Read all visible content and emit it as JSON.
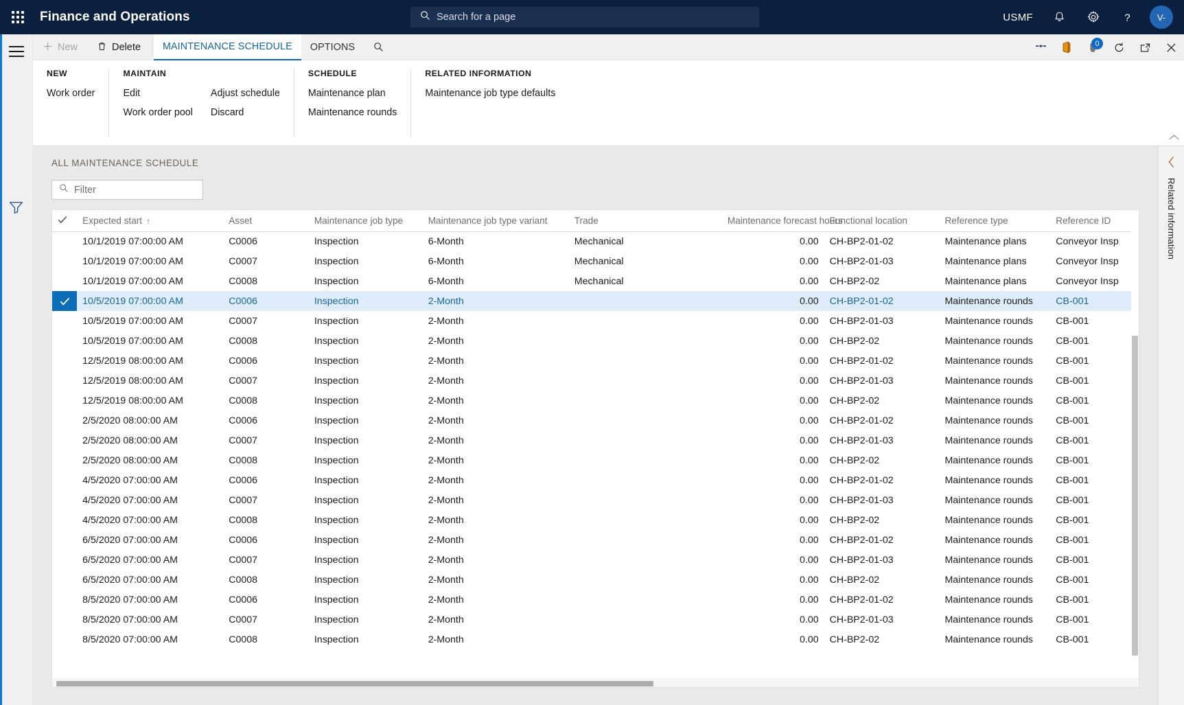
{
  "header": {
    "app_title": "Finance and Operations",
    "waffle_icon": "app-launcher-icon",
    "search": {
      "placeholder": "Search for a page",
      "icon": "search-icon"
    },
    "company": "USMF",
    "notifications_icon": "bell-icon",
    "settings_icon": "gear-icon",
    "help_icon": "question-icon",
    "avatar_initials": "V-",
    "accent_color": "#0b1f3f"
  },
  "left_rail": {
    "menu_icon": "hamburger-menu-icon",
    "filter_icon": "filter-funnel-icon"
  },
  "action_pane": {
    "buttons": [
      {
        "label": "New",
        "icon": "plus-icon",
        "disabled": true
      },
      {
        "label": "Delete",
        "icon": "trash-icon",
        "disabled": false
      }
    ],
    "tabs": [
      {
        "label": "MAINTENANCE SCHEDULE",
        "active": true
      },
      {
        "label": "OPTIONS",
        "active": false
      }
    ],
    "tab_search_icon": "search-icon",
    "right_icons": [
      {
        "name": "share-icon",
        "badge": null
      },
      {
        "name": "office-app-icon",
        "badge": null
      },
      {
        "name": "attachment-icon",
        "badge": "0"
      },
      {
        "name": "refresh-icon",
        "badge": null
      },
      {
        "name": "popout-icon",
        "badge": null
      },
      {
        "name": "close-icon",
        "badge": null
      }
    ],
    "collapse_icon": "chevron-up-icon",
    "groups": [
      {
        "title": "NEW",
        "columns": [
          {
            "items": [
              "Work order"
            ]
          }
        ]
      },
      {
        "title": "MAINTAIN",
        "columns": [
          {
            "items": [
              "Edit",
              "Work order pool"
            ]
          },
          {
            "items": [
              "Adjust schedule",
              "Discard"
            ]
          }
        ]
      },
      {
        "title": "SCHEDULE",
        "columns": [
          {
            "items": [
              "Maintenance plan",
              "Maintenance rounds"
            ]
          }
        ]
      },
      {
        "title": "RELATED INFORMATION",
        "columns": [
          {
            "items": [
              "Maintenance job type defaults"
            ]
          }
        ]
      }
    ]
  },
  "content": {
    "grid_caption": "ALL MAINTENANCE SCHEDULE",
    "filter": {
      "placeholder": "Filter",
      "value": "",
      "icon": "search-icon"
    }
  },
  "grid": {
    "select_all_icon": "checkmark-icon",
    "sort_indicator": "↑",
    "columns": [
      {
        "key": "expected_start",
        "label": "Expected start",
        "sorted": true
      },
      {
        "key": "asset",
        "label": "Asset"
      },
      {
        "key": "job_type",
        "label": "Maintenance job type"
      },
      {
        "key": "job_type_variant",
        "label": "Maintenance job type variant"
      },
      {
        "key": "trade",
        "label": "Trade"
      },
      {
        "key": "forecast_hours",
        "label": "Maintenance forecast hours",
        "align": "right"
      },
      {
        "key": "functional_location",
        "label": "Functional location"
      },
      {
        "key": "reference_type",
        "label": "Reference type"
      },
      {
        "key": "reference_id",
        "label": "Reference ID"
      }
    ],
    "rows": [
      {
        "selected": false,
        "expected_start": "10/1/2019 07:00:00 AM",
        "asset": "C0006",
        "job_type": "Inspection",
        "job_type_variant": "6-Month",
        "trade": "Mechanical",
        "forecast_hours": "0.00",
        "functional_location": "CH-BP2-01-02",
        "reference_type": "Maintenance plans",
        "reference_id": "Conveyor Insp"
      },
      {
        "selected": false,
        "expected_start": "10/1/2019 07:00:00 AM",
        "asset": "C0007",
        "job_type": "Inspection",
        "job_type_variant": "6-Month",
        "trade": "Mechanical",
        "forecast_hours": "0.00",
        "functional_location": "CH-BP2-01-03",
        "reference_type": "Maintenance plans",
        "reference_id": "Conveyor Insp"
      },
      {
        "selected": false,
        "expected_start": "10/1/2019 07:00:00 AM",
        "asset": "C0008",
        "job_type": "Inspection",
        "job_type_variant": "6-Month",
        "trade": "Mechanical",
        "forecast_hours": "0.00",
        "functional_location": "CH-BP2-02",
        "reference_type": "Maintenance plans",
        "reference_id": "Conveyor Insp"
      },
      {
        "selected": true,
        "expected_start": "10/5/2019 07:00:00 AM",
        "asset": "C0006",
        "job_type": "Inspection",
        "job_type_variant": "2-Month",
        "trade": "",
        "forecast_hours": "0.00",
        "functional_location": "CH-BP2-01-02",
        "reference_type": "Maintenance rounds",
        "reference_id": "CB-001"
      },
      {
        "selected": false,
        "expected_start": "10/5/2019 07:00:00 AM",
        "asset": "C0007",
        "job_type": "Inspection",
        "job_type_variant": "2-Month",
        "trade": "",
        "forecast_hours": "0.00",
        "functional_location": "CH-BP2-01-03",
        "reference_type": "Maintenance rounds",
        "reference_id": "CB-001"
      },
      {
        "selected": false,
        "expected_start": "10/5/2019 07:00:00 AM",
        "asset": "C0008",
        "job_type": "Inspection",
        "job_type_variant": "2-Month",
        "trade": "",
        "forecast_hours": "0.00",
        "functional_location": "CH-BP2-02",
        "reference_type": "Maintenance rounds",
        "reference_id": "CB-001"
      },
      {
        "selected": false,
        "expected_start": "12/5/2019 08:00:00 AM",
        "asset": "C0006",
        "job_type": "Inspection",
        "job_type_variant": "2-Month",
        "trade": "",
        "forecast_hours": "0.00",
        "functional_location": "CH-BP2-01-02",
        "reference_type": "Maintenance rounds",
        "reference_id": "CB-001"
      },
      {
        "selected": false,
        "expected_start": "12/5/2019 08:00:00 AM",
        "asset": "C0007",
        "job_type": "Inspection",
        "job_type_variant": "2-Month",
        "trade": "",
        "forecast_hours": "0.00",
        "functional_location": "CH-BP2-01-03",
        "reference_type": "Maintenance rounds",
        "reference_id": "CB-001"
      },
      {
        "selected": false,
        "expected_start": "12/5/2019 08:00:00 AM",
        "asset": "C0008",
        "job_type": "Inspection",
        "job_type_variant": "2-Month",
        "trade": "",
        "forecast_hours": "0.00",
        "functional_location": "CH-BP2-02",
        "reference_type": "Maintenance rounds",
        "reference_id": "CB-001"
      },
      {
        "selected": false,
        "expected_start": "2/5/2020 08:00:00 AM",
        "asset": "C0006",
        "job_type": "Inspection",
        "job_type_variant": "2-Month",
        "trade": "",
        "forecast_hours": "0.00",
        "functional_location": "CH-BP2-01-02",
        "reference_type": "Maintenance rounds",
        "reference_id": "CB-001"
      },
      {
        "selected": false,
        "expected_start": "2/5/2020 08:00:00 AM",
        "asset": "C0007",
        "job_type": "Inspection",
        "job_type_variant": "2-Month",
        "trade": "",
        "forecast_hours": "0.00",
        "functional_location": "CH-BP2-01-03",
        "reference_type": "Maintenance rounds",
        "reference_id": "CB-001"
      },
      {
        "selected": false,
        "expected_start": "2/5/2020 08:00:00 AM",
        "asset": "C0008",
        "job_type": "Inspection",
        "job_type_variant": "2-Month",
        "trade": "",
        "forecast_hours": "0.00",
        "functional_location": "CH-BP2-02",
        "reference_type": "Maintenance rounds",
        "reference_id": "CB-001"
      },
      {
        "selected": false,
        "expected_start": "4/5/2020 07:00:00 AM",
        "asset": "C0006",
        "job_type": "Inspection",
        "job_type_variant": "2-Month",
        "trade": "",
        "forecast_hours": "0.00",
        "functional_location": "CH-BP2-01-02",
        "reference_type": "Maintenance rounds",
        "reference_id": "CB-001"
      },
      {
        "selected": false,
        "expected_start": "4/5/2020 07:00:00 AM",
        "asset": "C0007",
        "job_type": "Inspection",
        "job_type_variant": "2-Month",
        "trade": "",
        "forecast_hours": "0.00",
        "functional_location": "CH-BP2-01-03",
        "reference_type": "Maintenance rounds",
        "reference_id": "CB-001"
      },
      {
        "selected": false,
        "expected_start": "4/5/2020 07:00:00 AM",
        "asset": "C0008",
        "job_type": "Inspection",
        "job_type_variant": "2-Month",
        "trade": "",
        "forecast_hours": "0.00",
        "functional_location": "CH-BP2-02",
        "reference_type": "Maintenance rounds",
        "reference_id": "CB-001"
      },
      {
        "selected": false,
        "expected_start": "6/5/2020 07:00:00 AM",
        "asset": "C0006",
        "job_type": "Inspection",
        "job_type_variant": "2-Month",
        "trade": "",
        "forecast_hours": "0.00",
        "functional_location": "CH-BP2-01-02",
        "reference_type": "Maintenance rounds",
        "reference_id": "CB-001"
      },
      {
        "selected": false,
        "expected_start": "6/5/2020 07:00:00 AM",
        "asset": "C0007",
        "job_type": "Inspection",
        "job_type_variant": "2-Month",
        "trade": "",
        "forecast_hours": "0.00",
        "functional_location": "CH-BP2-01-03",
        "reference_type": "Maintenance rounds",
        "reference_id": "CB-001"
      },
      {
        "selected": false,
        "expected_start": "6/5/2020 07:00:00 AM",
        "asset": "C0008",
        "job_type": "Inspection",
        "job_type_variant": "2-Month",
        "trade": "",
        "forecast_hours": "0.00",
        "functional_location": "CH-BP2-02",
        "reference_type": "Maintenance rounds",
        "reference_id": "CB-001"
      },
      {
        "selected": false,
        "expected_start": "8/5/2020 07:00:00 AM",
        "asset": "C0006",
        "job_type": "Inspection",
        "job_type_variant": "2-Month",
        "trade": "",
        "forecast_hours": "0.00",
        "functional_location": "CH-BP2-01-02",
        "reference_type": "Maintenance rounds",
        "reference_id": "CB-001"
      },
      {
        "selected": false,
        "expected_start": "8/5/2020 07:00:00 AM",
        "asset": "C0007",
        "job_type": "Inspection",
        "job_type_variant": "2-Month",
        "trade": "",
        "forecast_hours": "0.00",
        "functional_location": "CH-BP2-01-03",
        "reference_type": "Maintenance rounds",
        "reference_id": "CB-001"
      },
      {
        "selected": false,
        "expected_start": "8/5/2020 07:00:00 AM",
        "asset": "C0008",
        "job_type": "Inspection",
        "job_type_variant": "2-Month",
        "trade": "",
        "forecast_hours": "0.00",
        "functional_location": "CH-BP2-02",
        "reference_type": "Maintenance rounds",
        "reference_id": "CB-001"
      }
    ]
  },
  "right_rail": {
    "label": "Related information",
    "chevron_icon": "chevron-left-icon"
  }
}
